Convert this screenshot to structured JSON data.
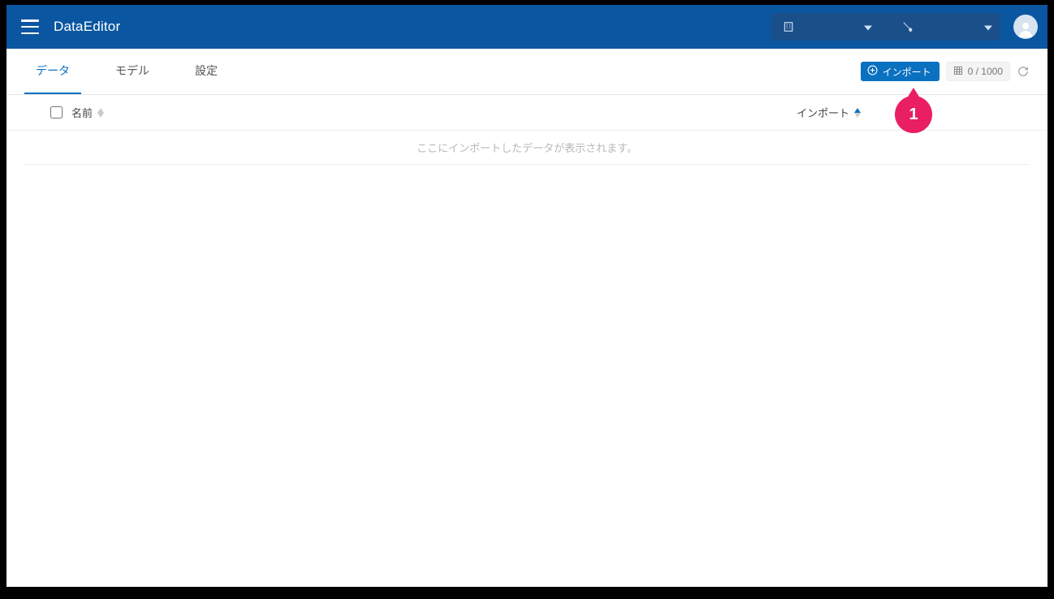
{
  "header": {
    "app_title": "DataEditor"
  },
  "breadcrumb": {
    "org_text": "",
    "env_text": ""
  },
  "tabs": [
    {
      "label": "データ",
      "active": true
    },
    {
      "label": "モデル",
      "active": false
    },
    {
      "label": "設定",
      "active": false
    }
  ],
  "toolbar": {
    "import_label": "インポート",
    "count_text": "0 / 1000"
  },
  "table": {
    "col_name": "名前",
    "col_import": "インポート",
    "empty_message": "ここにインポートしたデータが表示されます。"
  },
  "callouts": {
    "one": "1"
  }
}
